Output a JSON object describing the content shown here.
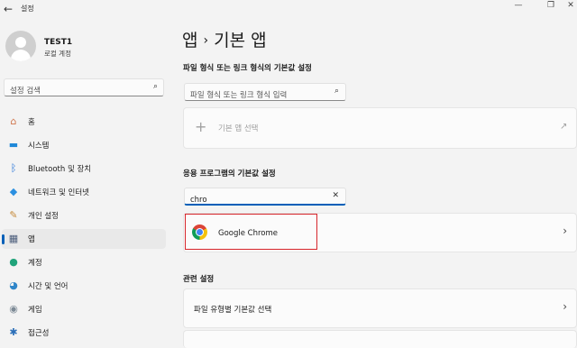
{
  "window": {
    "title": "설정",
    "back_glyph": "←",
    "min_glyph": "—",
    "max_glyph": "❐",
    "close_glyph": "✕"
  },
  "user": {
    "name": "TEST1",
    "account_type": "로컬 계정"
  },
  "search": {
    "placeholder": "설정 검색",
    "icon": "search-icon"
  },
  "sidebar": {
    "items": [
      {
        "label": "홈",
        "icon": "home-icon",
        "glyph": "⌂",
        "color": "#d0754b",
        "selected": false
      },
      {
        "label": "시스템",
        "icon": "monitor-icon",
        "glyph": "▬",
        "color": "#1f88d8",
        "selected": false
      },
      {
        "label": "Bluetooth 및 장치",
        "icon": "bluetooth-icon",
        "glyph": "ᛒ",
        "color": "#1f6fd8",
        "selected": false
      },
      {
        "label": "네트워크 및 인터넷",
        "icon": "wifi-icon",
        "glyph": "◆",
        "color": "#2b8fe0",
        "selected": false
      },
      {
        "label": "개인 설정",
        "icon": "brush-icon",
        "glyph": "✎",
        "color": "#c58a3b",
        "selected": false
      },
      {
        "label": "앱",
        "icon": "apps-icon",
        "glyph": "▦",
        "color": "#4a5c7a",
        "selected": true
      },
      {
        "label": "계정",
        "icon": "person-icon",
        "glyph": "●",
        "color": "#20a37a",
        "selected": false
      },
      {
        "label": "시간 및 언어",
        "icon": "globe-clock-icon",
        "glyph": "◕",
        "color": "#2f86c9",
        "selected": false
      },
      {
        "label": "게임",
        "icon": "gamepad-icon",
        "glyph": "◉",
        "color": "#7d8a96",
        "selected": false
      },
      {
        "label": "접근성",
        "icon": "accessibility-icon",
        "glyph": "✱",
        "color": "#2c6fb8",
        "selected": false
      }
    ]
  },
  "main": {
    "breadcrumb_parent": "앱",
    "breadcrumb_sep": "›",
    "breadcrumb_current": "기본 앱",
    "file_section_title": "파일 형식 또는 링크 형식의 기본값 설정",
    "file_input_placeholder": "파일 형식 또는 링크 형식 입력",
    "choose_default_label": "기본 앱 선택",
    "plus_glyph": "+",
    "external_glyph": "↗",
    "apps_section_title": "응용 프로그램의 기본값 설정",
    "apps_search_value": "chro",
    "clear_glyph": "✕",
    "result_app_name": "Google Chrome",
    "related_title": "관련 설정",
    "related_item_label": "파일 유형별 기본값 선택",
    "chevron_glyph": "›",
    "highlight_color": "#d7262b"
  }
}
